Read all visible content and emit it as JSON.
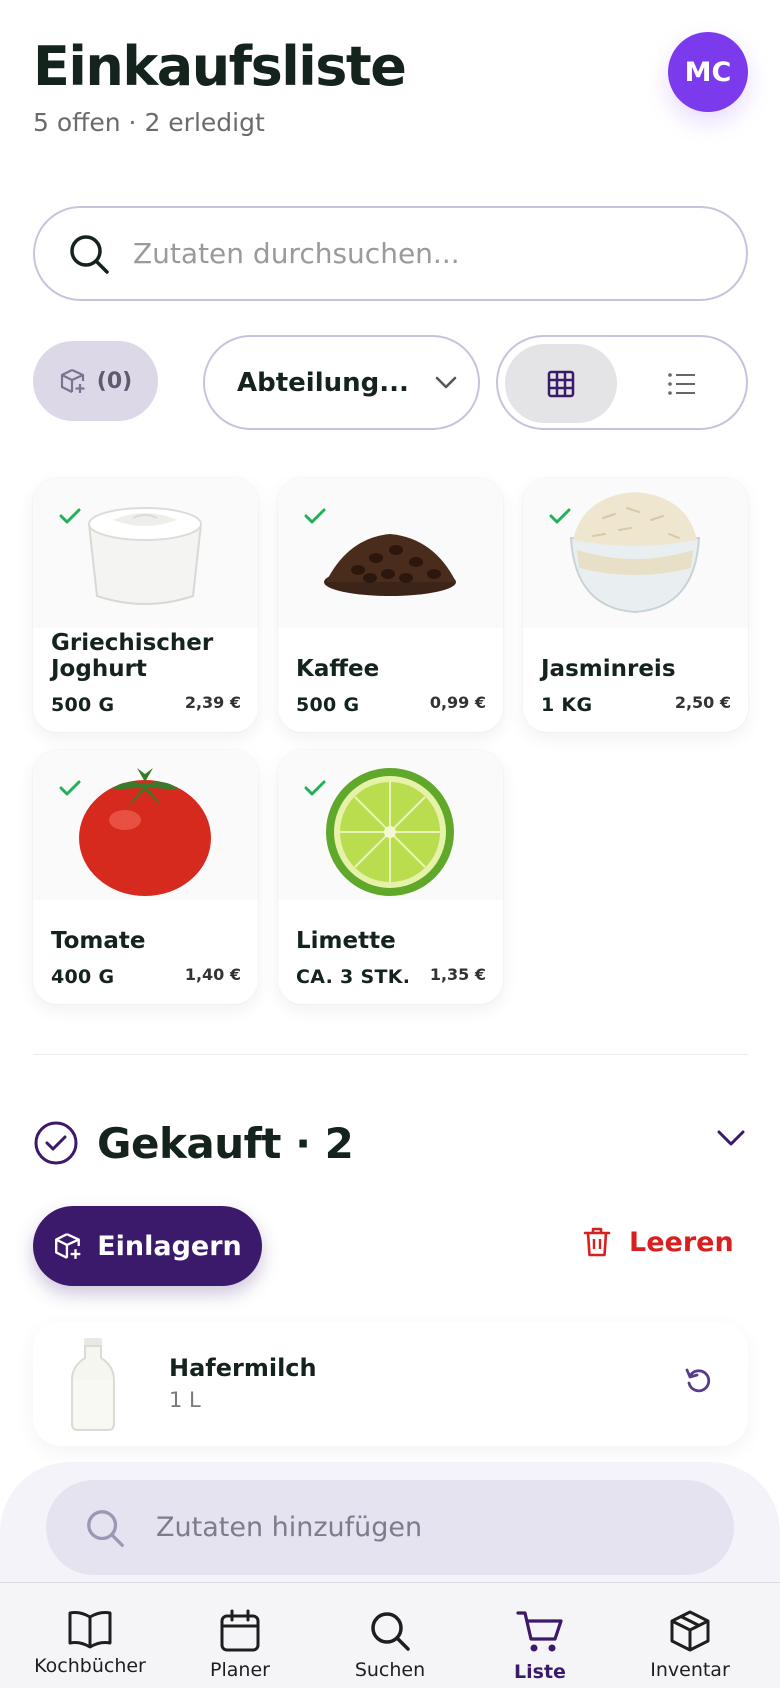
{
  "header": {
    "title": "Einkaufsliste",
    "subtitle": "5 offen · 2 erledigt",
    "avatar_initials": "MC"
  },
  "search": {
    "placeholder": "Zutaten durchsuchen..."
  },
  "filters": {
    "pantry_count": "(0)",
    "department_label": "Abteilung...",
    "view_mode": "grid"
  },
  "items": [
    {
      "name": "Griechischer Joghurt",
      "qty": "500 G",
      "price": "2,39 €",
      "checked": true,
      "image": "yogurt"
    },
    {
      "name": "Kaffee",
      "qty": "500 G",
      "price": "0,99 €",
      "checked": true,
      "image": "coffee-beans"
    },
    {
      "name": "Jasminreis",
      "qty": "1 KG",
      "price": "2,50 €",
      "checked": true,
      "image": "rice"
    },
    {
      "name": "Tomate",
      "qty": "400 G",
      "price": "1,40 €",
      "checked": true,
      "image": "tomato"
    },
    {
      "name": "Limette",
      "qty": "CA. 3 STK.",
      "price": "1,35 €",
      "checked": true,
      "image": "lime"
    }
  ],
  "bought": {
    "title": "Gekauft · 2",
    "store_label": "Einlagern",
    "clear_label": "Leeren",
    "items": [
      {
        "name": "Hafermilch",
        "qty": "1 L",
        "image": "oat-milk-bottle"
      }
    ]
  },
  "add": {
    "placeholder": "Zutaten hinzufügen"
  },
  "tabs": [
    {
      "label": "Kochbücher",
      "icon": "book-icon"
    },
    {
      "label": "Planer",
      "icon": "calendar-icon"
    },
    {
      "label": "Suchen",
      "icon": "search-icon"
    },
    {
      "label": "Liste",
      "icon": "cart-icon",
      "active": true
    },
    {
      "label": "Inventar",
      "icon": "box-icon"
    }
  ],
  "colors": {
    "accent": "#7c3aed",
    "primary_dark": "#3b1a6b",
    "danger": "#d92020",
    "check": "#22b15a"
  }
}
